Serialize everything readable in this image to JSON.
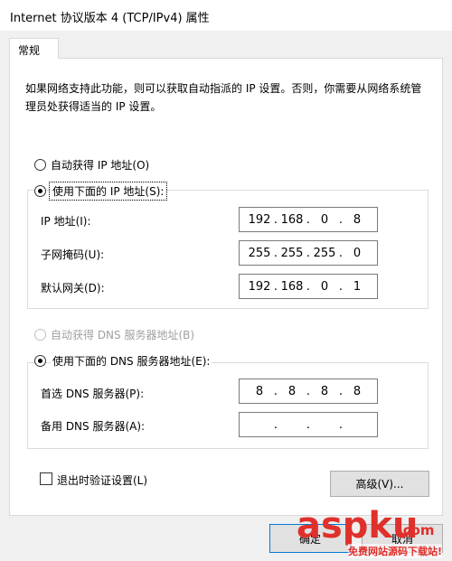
{
  "window": {
    "title": "Internet 协议版本 4 (TCP/IPv4) 属性"
  },
  "tabs": [
    {
      "label": "常规"
    }
  ],
  "description": "如果网络支持此功能，则可以获取自动指派的 IP 设置。否则，你需要从网络系统管理员处获得适当的 IP 设置。",
  "ip_section": {
    "auto_label": "自动获得 IP 地址(O)",
    "manual_label": "使用下面的 IP 地址(S):",
    "selected": "manual",
    "fields": [
      {
        "label": "IP 地址(I):",
        "octets": [
          "192",
          "168",
          "0",
          "8"
        ]
      },
      {
        "label": "子网掩码(U):",
        "octets": [
          "255",
          "255",
          "255",
          "0"
        ]
      },
      {
        "label": "默认网关(D):",
        "octets": [
          "192",
          "168",
          "0",
          "1"
        ]
      }
    ]
  },
  "dns_section": {
    "auto_label": "自动获得 DNS 服务器地址(B)",
    "manual_label": "使用下面的 DNS 服务器地址(E):",
    "selected": "manual",
    "fields": [
      {
        "label": "首选 DNS 服务器(P):",
        "octets": [
          "8",
          "8",
          "8",
          "8"
        ]
      },
      {
        "label": "备用 DNS 服务器(A):",
        "octets": [
          "",
          "",
          "",
          ""
        ]
      }
    ]
  },
  "validate_checkbox": {
    "label": "退出时验证设置(L)",
    "checked": false
  },
  "buttons": {
    "advanced": "高级(V)...",
    "ok": "确定",
    "cancel": "取消"
  },
  "watermark": {
    "brand": "aspku",
    "domain": ".com",
    "tagline": "免费网站源码下载站!"
  },
  "colors": {
    "panel": "#ffffff",
    "window": "#f0f0f0",
    "watermark_red": "#e0302b"
  }
}
